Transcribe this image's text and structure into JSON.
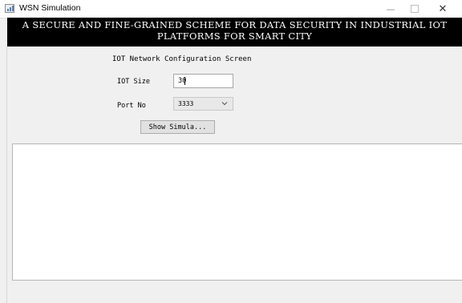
{
  "window": {
    "title": "WSN Simulation",
    "minimize_glyph": "—",
    "close_glyph": "✕"
  },
  "banner": {
    "line1": "A SECURE AND FINE-GRAINED SCHEME FOR DATA SECURITY IN INDUSTRIAL IOT",
    "line2": "PLATFORMS FOR SMART CITY"
  },
  "form": {
    "screen_title": "IOT Network Configuration Screen",
    "iot_size_label": "IOT Size",
    "iot_size_value": "30",
    "port_label": "Port No",
    "port_value": "3333",
    "show_button_label": "Show Simula..."
  },
  "output": {
    "text": ""
  },
  "icons": {
    "app": "bar-chart-window-icon",
    "dropdown": "chevron-down-icon"
  },
  "colors": {
    "banner_bg": "#000000",
    "banner_fg": "#ffffff",
    "window_bg": "#f0f0f0"
  }
}
